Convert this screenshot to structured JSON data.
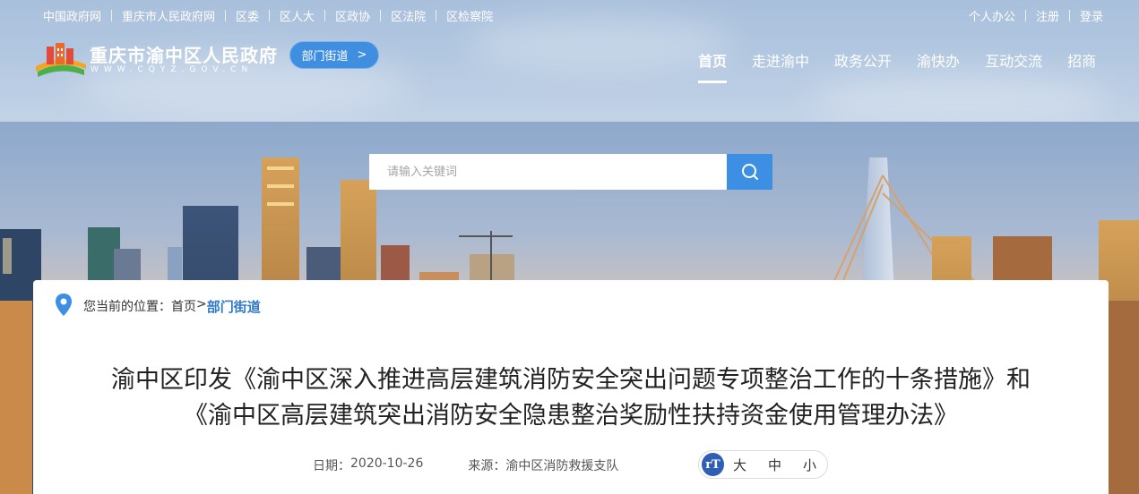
{
  "top_links": [
    "中国政府网",
    "重庆市人民政府网",
    "区委",
    "区人大",
    "区政协",
    "区法院",
    "区检察院"
  ],
  "user_links": [
    "个人办公",
    "注册",
    "登录"
  ],
  "site": {
    "title": "重庆市渝中区人民政府",
    "domain": "WWW.CQYZ.GOV.CN"
  },
  "dept_button": {
    "label": "部门街道",
    "arrow": ">"
  },
  "nav": {
    "items": [
      "首页",
      "走进渝中",
      "政务公开",
      "渝快办",
      "互动交流",
      "招商"
    ],
    "active": "首页"
  },
  "search": {
    "placeholder": "请输入关键词",
    "icon": "search-icon"
  },
  "breadcrumb": {
    "prefix": "您当前的位置：",
    "home": "首页",
    "separator": ">",
    "current": "部门街道",
    "icon": "location-pin-icon"
  },
  "article": {
    "title_line1": "渝中区印发《渝中区深入推进高层建筑消防安全突出问题专项整治工作的十条措施》和",
    "title_line2": "《渝中区高层建筑突出消防安全隐患整治奖励性扶持资金使用管理办法》",
    "date_label": "日期：",
    "date": "2020-10-26",
    "source_label": "来源：",
    "source": "渝中区消防救援支队"
  },
  "font_size": {
    "icon": "font-size-icon",
    "icon_text": "rT",
    "options": [
      "大",
      "中",
      "小"
    ]
  },
  "colors": {
    "accent": "#3d8fe4",
    "breadcrumb_current": "#2f79c9",
    "font_icon_bg": "#2f5fb4"
  }
}
